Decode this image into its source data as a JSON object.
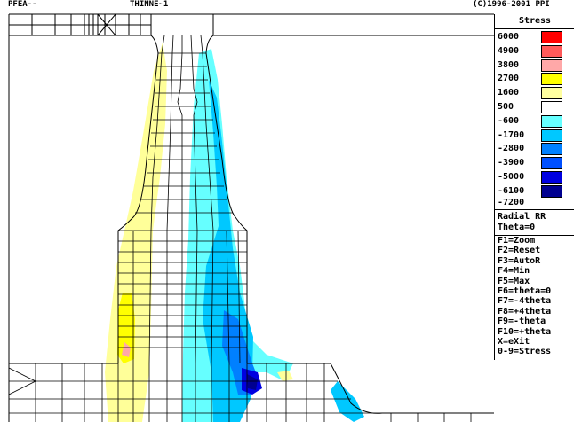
{
  "header": {
    "app": "PFEA--",
    "file": "THINNE~1",
    "copyright": "(C)1996-2001 PPI"
  },
  "legend": {
    "title": "Stress",
    "entries": [
      {
        "label": "6000",
        "color": "#ff0000"
      },
      {
        "label": "4900",
        "color": "#ff5a5a"
      },
      {
        "label": "3800",
        "color": "#ffa8a8"
      },
      {
        "label": "2700",
        "color": "#ffff00"
      },
      {
        "label": "1600",
        "color": "#ffffa0"
      },
      {
        "label": "500",
        "color": "#ffffff"
      },
      {
        "label": "-600",
        "color": "#66ffff"
      },
      {
        "label": "-1700",
        "color": "#00c8ff"
      },
      {
        "label": "-2800",
        "color": "#0080ff"
      },
      {
        "label": "-3900",
        "color": "#0050ff"
      },
      {
        "label": "-5000",
        "color": "#0000e0"
      },
      {
        "label": "-6100",
        "color": "#000090"
      }
    ],
    "min_label": "-7200"
  },
  "mode": {
    "component": "Radial RR",
    "theta": "Theta=0"
  },
  "keys": [
    "F1=Zoom",
    "F2=Reset",
    "F3=AutoR",
    "F4=Min",
    "F5=Max",
    "F6=theta=0",
    "F7=-4theta",
    "F8=+4theta",
    "F9=-theta",
    "F10=+theta",
    "X=eXit",
    "0-9=Stress"
  ],
  "contour_colors": {
    "yellow": "#ffff99",
    "yellow_strong": "#ffff00",
    "pink": "#ffa8a8",
    "cyan_light": "#66ffff",
    "cyan": "#00c8ff",
    "blue": "#0080ff",
    "blue_dark": "#0000e0",
    "navy": "#000090"
  }
}
